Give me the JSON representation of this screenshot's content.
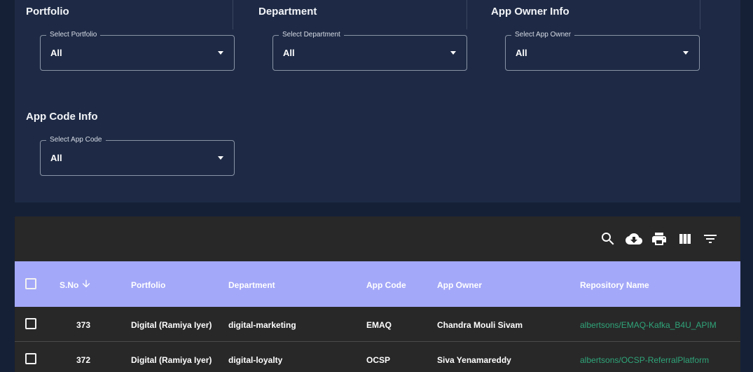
{
  "filters": {
    "portfolio": {
      "title": "Portfolio",
      "label": "Select Portfolio",
      "value": "All"
    },
    "department": {
      "title": "Department",
      "label": "Select Department",
      "value": "All"
    },
    "app_owner": {
      "title": "App Owner Info",
      "label": "Select App Owner",
      "value": "All"
    },
    "app_code": {
      "title": "App Code Info",
      "label": "Select App Code",
      "value": "All"
    }
  },
  "toolbar": {
    "icons": [
      "search-icon",
      "cloud-download-icon",
      "print-icon",
      "view-columns-icon",
      "filter-list-icon"
    ]
  },
  "table": {
    "headers": {
      "sno": "S.No",
      "portfolio": "Portfolio",
      "department": "Department",
      "app_code": "App Code",
      "app_owner": "App Owner",
      "repository": "Repository Name"
    },
    "sort": {
      "column": "S.No",
      "direction": "descending"
    },
    "rows": [
      {
        "sno": "373",
        "portfolio": "Digital (Ramiya Iyer)",
        "department": "digital-marketing",
        "app_code": "EMAQ",
        "app_owner": "Chandra Mouli Sivam",
        "repository": "albertsons/EMAQ-Kafka_B4U_APIM"
      },
      {
        "sno": "372",
        "portfolio": "Digital (Ramiya Iyer)",
        "department": "digital-loyalty",
        "app_code": "OCSP",
        "app_owner": "Siva Yenamareddy",
        "repository": "albertsons/OCSP-ReferralPlatform"
      }
    ]
  },
  "colors": {
    "page_bg": "#152036",
    "filter_panel_bg": "#1e2a45",
    "table_bg": "#282828",
    "header_bg": "#a4a8f8",
    "link": "#2fa57a"
  }
}
